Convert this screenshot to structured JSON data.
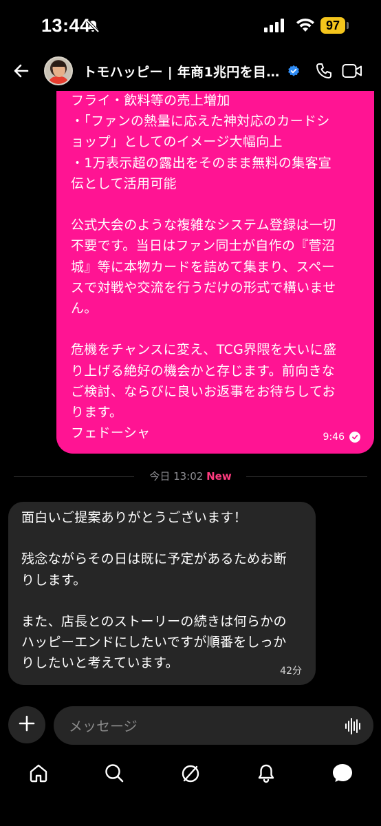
{
  "status_bar": {
    "time": "13:44",
    "battery": "97"
  },
  "header": {
    "contact_name": "トモハッピー | 年商1兆円を目…"
  },
  "messages": {
    "outgoing": {
      "lines": [
        "フライ・飲料等の売上増加",
        "・「ファンの熱量に応えた神対応のカードシ",
        "ョップ」としてのイメージ大幅向上",
        "・1万表示超の露出をそのまま無料の集客宣",
        "伝として活用可能",
        "",
        "公式大会のような複雑なシステム登録は一切",
        "不要です。当日はファン同士が自作の『菅沼",
        "城』等に本物カードを詰めて集まり、スペー",
        "スで対戦や交流を行うだけの形式で構いませ",
        "ん。",
        "",
        "危機をチャンスに変え、TCG界隈を大いに盛",
        "り上げる絶好の機会かと存じます。前向きな",
        "ご検討、ならびに良いお返事をお待ちしてお",
        "ります。",
        "フェドーシャ"
      ],
      "time": "9:46"
    },
    "divider": {
      "date_label": "今日 13:02",
      "new_label": "New"
    },
    "incoming": {
      "lines": [
        "面白いご提案ありがとうございます！",
        "",
        "残念ながらその日は既に予定があるためお断",
        "りします。",
        "",
        "また、店長とのストーリーの続きは何らかの",
        "ハッピーエンドにしたいですが順番をしっか",
        "りしたいと考えています。"
      ],
      "time": "42分"
    }
  },
  "composer": {
    "placeholder": "メッセージ"
  },
  "tabbar": {
    "items": [
      "home-icon",
      "search-icon",
      "explore-icon",
      "notifications-icon",
      "messages-icon"
    ]
  },
  "colors": {
    "outgoing_bubble": "#ff1493",
    "incoming_bubble": "#262626",
    "new_badge": "#ff3b7f",
    "verified": "#2f8cf5",
    "battery": "#f4c51c"
  }
}
